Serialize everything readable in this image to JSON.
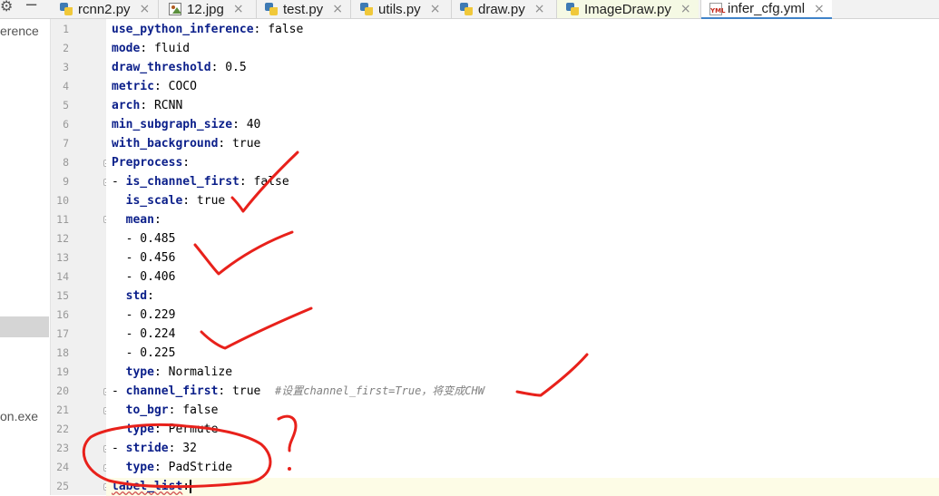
{
  "tabs": [
    {
      "name": "rcnn2.py",
      "icon": "python-icon"
    },
    {
      "name": "12.jpg",
      "icon": "image-icon"
    },
    {
      "name": "test.py",
      "icon": "python-icon"
    },
    {
      "name": "utils.py",
      "icon": "python-icon"
    },
    {
      "name": "draw.py",
      "icon": "python-icon"
    },
    {
      "name": "ImageDraw.py",
      "icon": "python-icon"
    },
    {
      "name": "infer_cfg.yml",
      "icon": "yml-icon",
      "active": true
    }
  ],
  "yml_icon_text": "YML",
  "tab_close_glyph": "×",
  "left_panel": {
    "item1": "erence",
    "item2": "on.exe"
  },
  "line_numbers": [
    "1",
    "2",
    "3",
    "4",
    "5",
    "6",
    "7",
    "8",
    "9",
    "10",
    "11",
    "12",
    "13",
    "14",
    "15",
    "16",
    "17",
    "18",
    "19",
    "20",
    "21",
    "22",
    "23",
    "24",
    "25"
  ],
  "code": {
    "l1": {
      "k": "use_python_inference",
      "v": ": false"
    },
    "l2": {
      "k": "mode",
      "v": ": fluid"
    },
    "l3": {
      "k": "draw_threshold",
      "v": ": 0.5"
    },
    "l4": {
      "k": "metric",
      "v": ": COCO"
    },
    "l5": {
      "k": "arch",
      "v": ": RCNN"
    },
    "l6": {
      "k": "min_subgraph_size",
      "v": ": 40"
    },
    "l7": {
      "k": "with_background",
      "v": ": true"
    },
    "l8": {
      "k": "Preprocess",
      "v": ":"
    },
    "l9": {
      "p": "- ",
      "k": "is_channel_first",
      "v": ": false"
    },
    "l10": {
      "p": "  ",
      "k": "is_scale",
      "v": ": true"
    },
    "l11": {
      "p": "  ",
      "k": "mean",
      "v": ":"
    },
    "l12": {
      "t": "  - 0.485"
    },
    "l13": {
      "t": "  - 0.456"
    },
    "l14": {
      "t": "  - 0.406"
    },
    "l15": {
      "p": "  ",
      "k": "std",
      "v": ":"
    },
    "l16": {
      "t": "  - 0.229"
    },
    "l17": {
      "t": "  - 0.224"
    },
    "l18": {
      "t": "  - 0.225"
    },
    "l19": {
      "p": "  ",
      "k": "type",
      "v": ": Normalize"
    },
    "l20": {
      "p": "- ",
      "k": "channel_first",
      "v": ": true  ",
      "c": "#设置channel_first=True，将变成CHW"
    },
    "l21": {
      "p": "  ",
      "k": "to_bgr",
      "v": ": false"
    },
    "l22": {
      "p": "  ",
      "k": "type",
      "v": ": Permute"
    },
    "l23": {
      "p": "- ",
      "k": "stride",
      "v": ": 32"
    },
    "l24": {
      "p": "  ",
      "k": "type",
      "v": ": PadStride"
    },
    "l25": {
      "k": "label_list",
      "v": ":"
    }
  },
  "annotation": {
    "question_mark": "?",
    "ink_color": "#e8211b"
  }
}
